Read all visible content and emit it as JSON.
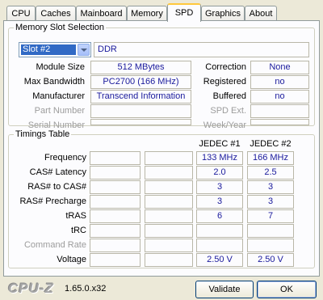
{
  "tabs": [
    {
      "label": "CPU"
    },
    {
      "label": "Caches"
    },
    {
      "label": "Mainboard"
    },
    {
      "label": "Memory"
    },
    {
      "label": "SPD"
    },
    {
      "label": "Graphics"
    },
    {
      "label": "About"
    }
  ],
  "memory_slot": {
    "title": "Memory Slot Selection",
    "slot": "Slot #2",
    "type": "DDR",
    "fields": {
      "module_size": {
        "label": "Module Size",
        "value": "512 MBytes"
      },
      "max_bandwidth": {
        "label": "Max Bandwidth",
        "value": "PC2700 (166 MHz)"
      },
      "manufacturer": {
        "label": "Manufacturer",
        "value": "Transcend Information"
      },
      "part_number": {
        "label": "Part Number",
        "value": ""
      },
      "serial_number": {
        "label": "Serial Number",
        "value": ""
      },
      "correction": {
        "label": "Correction",
        "value": "None"
      },
      "registered": {
        "label": "Registered",
        "value": "no"
      },
      "buffered": {
        "label": "Buffered",
        "value": "no"
      },
      "spd_ext": {
        "label": "SPD Ext.",
        "value": ""
      },
      "week_year": {
        "label": "Week/Year",
        "value": ""
      }
    }
  },
  "timings": {
    "title": "Timings Table",
    "columns": [
      "JEDEC #1",
      "JEDEC #2"
    ],
    "rows": [
      {
        "label": "Frequency",
        "dim": false,
        "jedec1": "133 MHz",
        "jedec2": "166 MHz"
      },
      {
        "label": "CAS# Latency",
        "dim": false,
        "jedec1": "2.0",
        "jedec2": "2.5"
      },
      {
        "label": "RAS# to CAS#",
        "dim": false,
        "jedec1": "3",
        "jedec2": "3"
      },
      {
        "label": "RAS# Precharge",
        "dim": false,
        "jedec1": "3",
        "jedec2": "3"
      },
      {
        "label": "tRAS",
        "dim": false,
        "jedec1": "6",
        "jedec2": "7"
      },
      {
        "label": "tRC",
        "dim": false,
        "jedec1": "",
        "jedec2": ""
      },
      {
        "label": "Command Rate",
        "dim": true,
        "jedec1": "",
        "jedec2": ""
      },
      {
        "label": "Voltage",
        "dim": false,
        "jedec1": "2.50 V",
        "jedec2": "2.50 V"
      }
    ]
  },
  "footer": {
    "logo": "CPU-Z",
    "version": "1.65.0.x32",
    "validate_label": "Validate",
    "ok_label": "OK"
  },
  "active_tab": "SPD",
  "colors": {
    "value_text": "#1a1a9c",
    "tab_highlight": "#ffc83c",
    "window_bg": "#ece9d8"
  }
}
